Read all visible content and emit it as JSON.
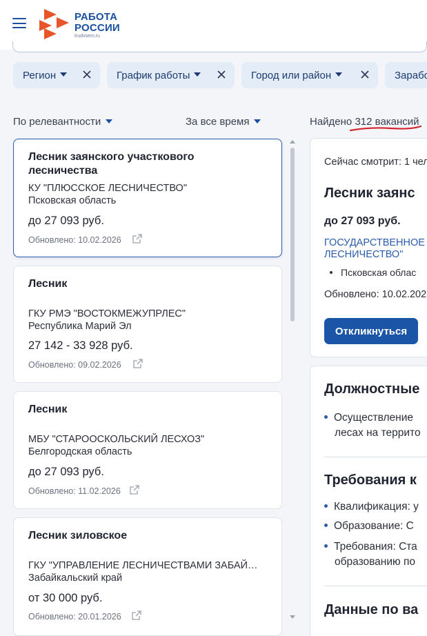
{
  "logo": {
    "line1": "РАБОТА",
    "line2": "РОССИИ",
    "sub": "trudvsem.ru"
  },
  "filters": [
    {
      "label": "Регион"
    },
    {
      "label": "График работы"
    },
    {
      "label": "Город или район"
    },
    {
      "label": "Зарабо"
    }
  ],
  "sort": {
    "relevance": "По релевантности",
    "period": "За все время"
  },
  "found": {
    "prefix": "Найдено ",
    "count": "312 вакансий"
  },
  "vacancies": [
    {
      "title": "Лесник заянского участкового лесничества",
      "org": "КУ \"ПЛЮССКОЕ ЛЕСНИЧЕСТВО\"",
      "region": "Псковская область",
      "salary": "до 27 093 руб.",
      "updated": "Обновлено: 10.02.2026"
    },
    {
      "title": "Лесник",
      "org": "ГКУ РМЭ \"ВОСТОКМЕЖУПРЛЕС\"",
      "region": "Республика Марий Эл",
      "salary": "27 142 - 33 928 руб.",
      "updated": "Обновлено: 09.02.2026"
    },
    {
      "title": "Лесник",
      "org": "МБУ \"СТАРООСКОЛЬСКИЙ ЛЕСХОЗ\"",
      "region": "Белгородская область",
      "salary": "до 27 093 руб.",
      "updated": "Обновлено: 11.02.2026"
    },
    {
      "title": "Лесник зиловское",
      "org": "ГКУ \"УПРАВЛЕНИЕ ЛЕСНИЧЕСТВАМИ ЗАБАЙ…",
      "region": "Забайкальский край",
      "salary": "от 30 000 руб.",
      "updated": "Обновлено: 20.01.2026"
    }
  ],
  "detail": {
    "watching": "Сейчас смотрит: 1 чел",
    "title": "Лесник заянс",
    "salary": "до 27 093 руб.",
    "org_line1": "ГОСУДАРСТВЕННОЕ",
    "org_line2": "ЛЕСНИЧЕСТВО\"",
    "region": "Псковская облас",
    "updated": "Обновлено: 10.02.202",
    "apply": "Откликнуться"
  },
  "detail2": {
    "duties_heading": "Должностные",
    "duties": [
      "Осуществление",
      "лесах на террито"
    ],
    "req_heading": "Требования к",
    "requirements": [
      {
        "line1": "Квалификация: у"
      },
      {
        "line1": "Образование: С"
      },
      {
        "line1": "Требования: Ста",
        "line2": "образованию по"
      }
    ],
    "data_heading": "Данные по ва"
  },
  "colors": {
    "accent": "#1a55a8",
    "underline": "#d4232e",
    "logo_orange": "#e8552b"
  }
}
